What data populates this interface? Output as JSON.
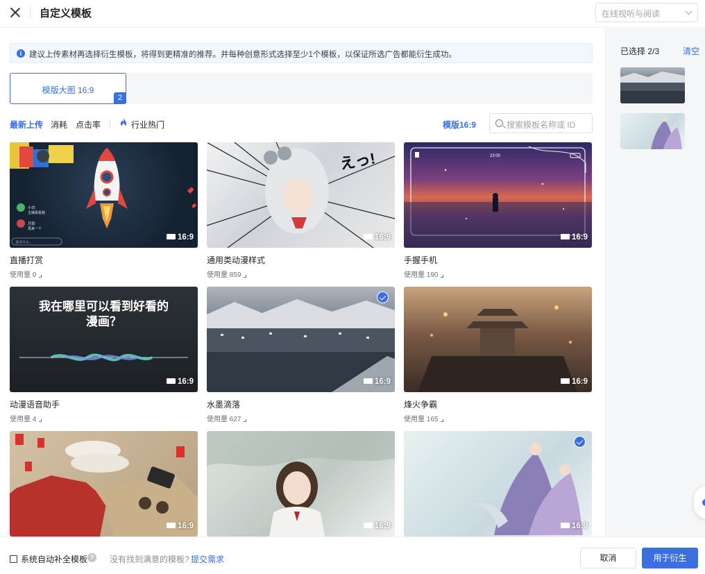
{
  "header": {
    "title": "自定义模板",
    "top_select_placeholder": "在线视听与阅读"
  },
  "notice": "建议上传素材再选择衍生模板，将得到更精准的推荐。并每种创意形式选择至少1个模板，以保证所选广告都能衍生成功。",
  "tabs": [
    {
      "label": "模版大图 16:9",
      "badge": "2"
    }
  ],
  "sort": {
    "options": [
      "最新上传",
      "消耗",
      "点击率"
    ],
    "hot_label": "行业热门"
  },
  "ratio_filter": "模版16:9",
  "search": {
    "placeholder": "搜索模板名称或 ID"
  },
  "templates": [
    {
      "name": "直播打赏",
      "usage": "使用量 0",
      "ratio": "16:9",
      "selected": false
    },
    {
      "name": "通用类动漫样式",
      "usage": "使用量 859",
      "ratio": "16:9",
      "selected": false
    },
    {
      "name": "手握手机",
      "usage": "使用量 190",
      "ratio": "16:9",
      "selected": false
    },
    {
      "name": "动漫语音助手",
      "usage": "使用量 4",
      "ratio": "16:9",
      "selected": false
    },
    {
      "name": "水墨滴落",
      "usage": "使用量 627",
      "ratio": "16:9",
      "selected": true
    },
    {
      "name": "烽火争霸",
      "usage": "使用量 165",
      "ratio": "16:9",
      "selected": false
    },
    {
      "name": "",
      "usage": "",
      "ratio": "16:9",
      "selected": false
    },
    {
      "name": "",
      "usage": "",
      "ratio": "16:9",
      "selected": false
    },
    {
      "name": "",
      "usage": "",
      "ratio": "16:9",
      "selected": true
    }
  ],
  "thumb_text": {
    "live_user1": "小白",
    "live_msg1": "主播看看我",
    "live_user2": "月影",
    "live_msg2": "再来一个",
    "live_input": "说点什么...",
    "anime_sfx": "えっ!",
    "phone_time": "23:00",
    "voice_caption": "我在哪里可以看到好看的漫画？"
  },
  "right_panel": {
    "count": "已选择 2/3",
    "clear": "清空"
  },
  "footer": {
    "autofill": "系统自动补全模板",
    "not_found": "没有找到满意的模板?",
    "submit_link": "提交需求",
    "cancel": "取消",
    "confirm": "用于衍生"
  },
  "colors": {
    "primary": "#3b6fe0",
    "notice_bg": "#f2f6fd",
    "panel_bg": "#f5f6f8"
  }
}
